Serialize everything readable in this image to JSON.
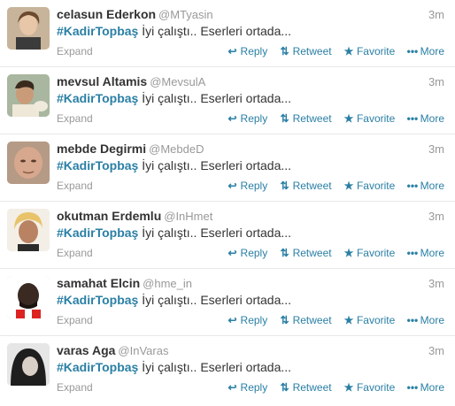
{
  "actions": {
    "reply": "Reply",
    "retweet": "Retweet",
    "favorite": "Favorite",
    "more": "More",
    "expand": "Expand"
  },
  "icons": {
    "reply": "reply-arrow-icon",
    "retweet": "retweet-icon",
    "favorite": "star-icon",
    "more": "ellipsis-icon"
  },
  "colors": {
    "link": "#2a7fa5",
    "muted": "#999999",
    "text": "#333333"
  },
  "tweets": [
    {
      "name": "celasun Ederkon",
      "handle": "@MTyasin",
      "time": "3m",
      "hashtag": "#KadirTopbaş",
      "text": " İyi çalıştı.. Eserleri ortada..."
    },
    {
      "name": "mevsul Altamis",
      "handle": "@MevsulA",
      "time": "3m",
      "hashtag": "#KadirTopbaş",
      "text": " İyi çalıştı.. Eserleri ortada..."
    },
    {
      "name": "mebde Degirmi",
      "handle": "@MebdeD",
      "time": "3m",
      "hashtag": "#KadirTopbaş",
      "text": " İyi çalıştı.. Eserleri ortada..."
    },
    {
      "name": "okutman Erdemlu",
      "handle": "@InHmet",
      "time": "3m",
      "hashtag": "#KadirTopbaş",
      "text": " İyi çalıştı.. Eserleri ortada..."
    },
    {
      "name": "samahat Elcin",
      "handle": "@hme_in",
      "time": "3m",
      "hashtag": "#KadirTopbaş",
      "text": " İyi çalıştı.. Eserleri ortada..."
    },
    {
      "name": "varas Aga",
      "handle": "@InVaras",
      "time": "3m",
      "hashtag": "#KadirTopbaş",
      "text": " İyi çalıştı.. Eserleri ortada..."
    }
  ]
}
